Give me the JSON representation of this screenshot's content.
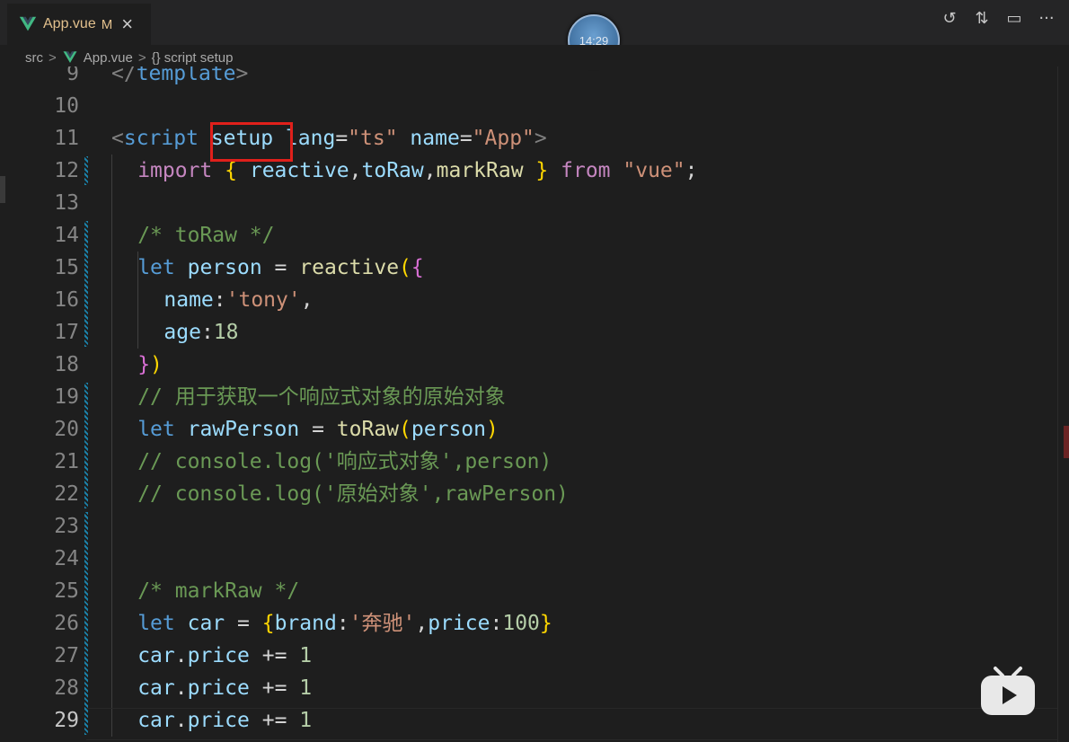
{
  "tab": {
    "filename": "App.vue",
    "modified": "M",
    "close": "×"
  },
  "timer": "14:29",
  "toolbar": {
    "icons": [
      "history-icon",
      "compare-icon",
      "split-editor-icon",
      "more-icon"
    ],
    "more": "···"
  },
  "breadcrumb": {
    "folder": "src",
    "file": "App.vue",
    "symbol": "{} script setup",
    "sep": ">"
  },
  "lines": [
    {
      "n": "9",
      "code": "</template>"
    },
    {
      "n": "10",
      "code": ""
    },
    {
      "n": "11",
      "code": "<script setup lang=\"ts\" name=\"App\">"
    },
    {
      "n": "12",
      "code": "import { reactive,toRaw,markRaw } from \"vue\";"
    },
    {
      "n": "13",
      "code": ""
    },
    {
      "n": "14",
      "code": "/* toRaw */"
    },
    {
      "n": "15",
      "code": "let person = reactive({"
    },
    {
      "n": "16",
      "code": "name:'tony',"
    },
    {
      "n": "17",
      "code": "age:18"
    },
    {
      "n": "18",
      "code": "})"
    },
    {
      "n": "19",
      "code": "// 用于获取一个响应式对象的原始对象"
    },
    {
      "n": "20",
      "code": "let rawPerson = toRaw(person)"
    },
    {
      "n": "21",
      "code": "// console.log('响应式对象',person)"
    },
    {
      "n": "22",
      "code": "// console.log('原始对象',rawPerson)"
    },
    {
      "n": "23",
      "code": ""
    },
    {
      "n": "24",
      "code": ""
    },
    {
      "n": "25",
      "code": "/* markRaw */"
    },
    {
      "n": "26",
      "code": "let car = {brand:'奔驰',price:100}"
    },
    {
      "n": "27",
      "code": "car.price += 1"
    },
    {
      "n": "28",
      "code": "car.price += 1"
    },
    {
      "n": "29",
      "code": "car.price += 1"
    }
  ],
  "highlight_word": "setup",
  "colors": {
    "keyword": "#569cd6",
    "string": "#ce9178",
    "comment": "#6a9955",
    "variable": "#9cdcfe",
    "function": "#dcdcaa",
    "number": "#b5cea8",
    "highlight_box": "#e0201b"
  }
}
